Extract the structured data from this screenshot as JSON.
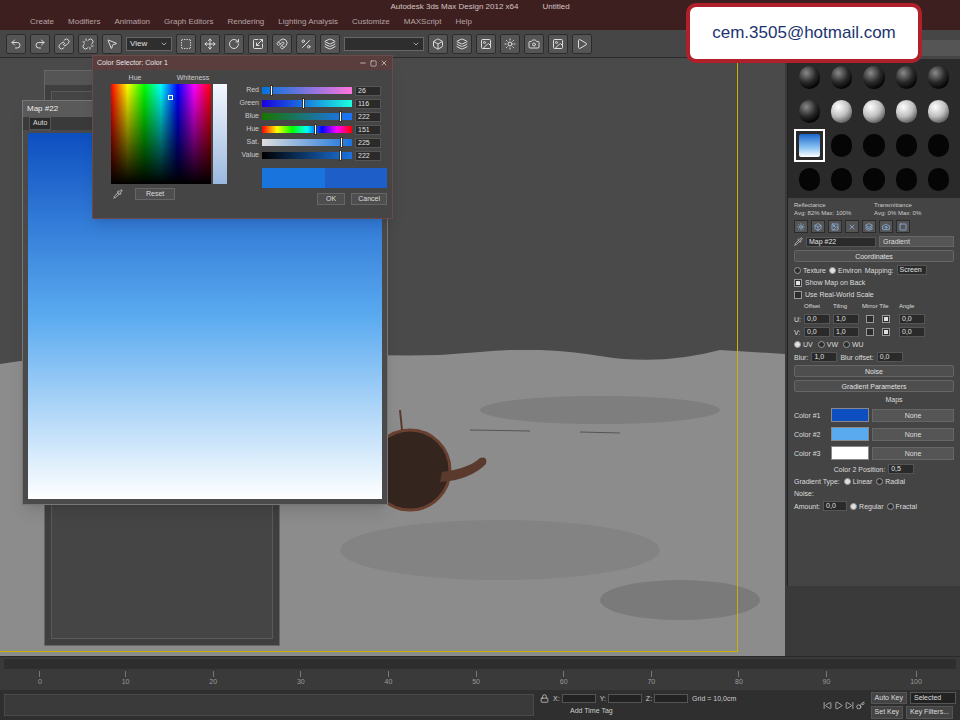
{
  "window": {
    "title": "Autodesk 3ds Max Design 2012 x64",
    "document": "Untitled"
  },
  "menu": [
    "Create",
    "Modifiers",
    "Animation",
    "Graph Editors",
    "Rendering",
    "Lighting Analysis",
    "Customize",
    "MAXScript",
    "Help"
  ],
  "toolbar": {
    "reference_coord": "View",
    "selection_set": ""
  },
  "badge": {
    "text": "cem.3505@hotmail.com"
  },
  "map_window": {
    "title": "Map #22",
    "display": "Auto"
  },
  "color_selector": {
    "title": "Color Selector: Color 1",
    "tabs": [
      "Hue",
      "Whiteness"
    ],
    "sliders": [
      {
        "label": "Red",
        "value": "26",
        "level": 0.1,
        "kind": "red"
      },
      {
        "label": "Green",
        "value": "116",
        "level": 0.45,
        "kind": "green"
      },
      {
        "label": "Blue",
        "value": "222",
        "level": 0.87,
        "kind": "blue"
      },
      {
        "label": "Hue",
        "value": "151",
        "level": 0.59,
        "kind": "hue"
      },
      {
        "label": "Sat.",
        "value": "225",
        "level": 0.88,
        "kind": "sat"
      },
      {
        "label": "Value",
        "value": "222",
        "level": 0.87,
        "kind": "value"
      }
    ],
    "new_color": "#1a74de",
    "old_color": "#1d5ec8",
    "buttons": [
      "Reset",
      "OK",
      "Cancel"
    ]
  },
  "material_editor": {
    "slots": [
      {
        "kind": "dark",
        "selected": false
      },
      {
        "kind": "dark",
        "selected": false
      },
      {
        "kind": "dark",
        "selected": false
      },
      {
        "kind": "dark",
        "selected": false
      },
      {
        "kind": "dark",
        "selected": false
      },
      {
        "kind": "dark",
        "selected": false
      },
      {
        "kind": "light",
        "selected": false
      },
      {
        "kind": "light",
        "selected": false
      },
      {
        "kind": "light",
        "selected": false
      },
      {
        "kind": "light",
        "selected": false
      },
      {
        "kind": "gradient",
        "selected": true
      },
      {
        "kind": "blank",
        "selected": false
      },
      {
        "kind": "blank",
        "selected": false
      },
      {
        "kind": "blank",
        "selected": false
      },
      {
        "kind": "blank",
        "selected": false
      },
      {
        "kind": "blank",
        "selected": false
      },
      {
        "kind": "blank",
        "selected": false
      },
      {
        "kind": "blank",
        "selected": false
      },
      {
        "kind": "blank",
        "selected": false
      },
      {
        "kind": "blank",
        "selected": false
      }
    ],
    "reflectance": {
      "label": "Reflectance",
      "reading": "Avg: 82% Max: 100%"
    },
    "transmittance": {
      "label": "Transmittance",
      "reading": "Avg: 0% Max: 0%"
    },
    "map_name": "Map #22",
    "map_type": "Gradient",
    "coordinates": {
      "title": "Coordinates",
      "sources": [
        {
          "label": "Texture",
          "selected": false
        },
        {
          "label": "Environ",
          "selected": true
        }
      ],
      "mapping_label": "Mapping:",
      "mapping": "Screen",
      "checks": [
        {
          "label": "Show Map on Back",
          "checked": true
        },
        {
          "label": "Use Real-World Scale",
          "checked": false
        }
      ],
      "columns": [
        "Offset",
        "Tiling",
        "Mirror Tile",
        "Angle"
      ],
      "rows": [
        {
          "axis": "U:",
          "offset": "0,0",
          "tiling": "1,0",
          "mirror": false,
          "tile": true,
          "angle": "0,0"
        },
        {
          "axis": "V:",
          "offset": "0,0",
          "tiling": "1,0",
          "mirror": false,
          "tile": true,
          "angle": "0,0"
        }
      ],
      "axes": [
        {
          "label": "UV",
          "selected": true
        },
        {
          "label": "VW",
          "selected": false
        },
        {
          "label": "WU",
          "selected": false
        }
      ],
      "blur": {
        "label": "Blur:",
        "value": "1,0"
      },
      "blur_offset": {
        "label": "Blur offset:",
        "value": "0,0"
      }
    },
    "noise_rollout": {
      "title": "Noise"
    },
    "gradient": {
      "title": "Gradient Parameters",
      "maps_label": "Maps",
      "colors": [
        {
          "label": "Color #1",
          "color": "#0d4fc0",
          "map": "None"
        },
        {
          "label": "Color #2",
          "color": "#5aaaf0",
          "map": "None"
        },
        {
          "label": "Color #3",
          "color": "#ffffff",
          "map": "None"
        }
      ],
      "position": {
        "label": "Color 2 Position:",
        "value": "0,5"
      },
      "type": {
        "label": "Gradient Type:",
        "options": [
          {
            "label": "Linear",
            "selected": true
          },
          {
            "label": "Radial",
            "selected": false
          }
        ]
      },
      "noise": {
        "label": "Noise:",
        "amount_label": "Amount:",
        "amount": "0,0",
        "options": [
          {
            "label": "Regular",
            "selected": true
          },
          {
            "label": "Fractal",
            "selected": false
          }
        ]
      }
    }
  },
  "timeline": {
    "ticks": [
      "0",
      "10",
      "20",
      "30",
      "40",
      "50",
      "60",
      "70",
      "80",
      "90",
      "100"
    ]
  },
  "status_bar": {
    "fields": [
      "X:",
      "Y:",
      "Z:"
    ],
    "grid": "Grid = 10,0cm",
    "add_time_tag": "Add Time Tag",
    "auto_key": {
      "label": "Auto Key",
      "on": false
    },
    "key_mode": "Selected",
    "set_key": "Set Key",
    "key_filters": "Key Filters..."
  }
}
